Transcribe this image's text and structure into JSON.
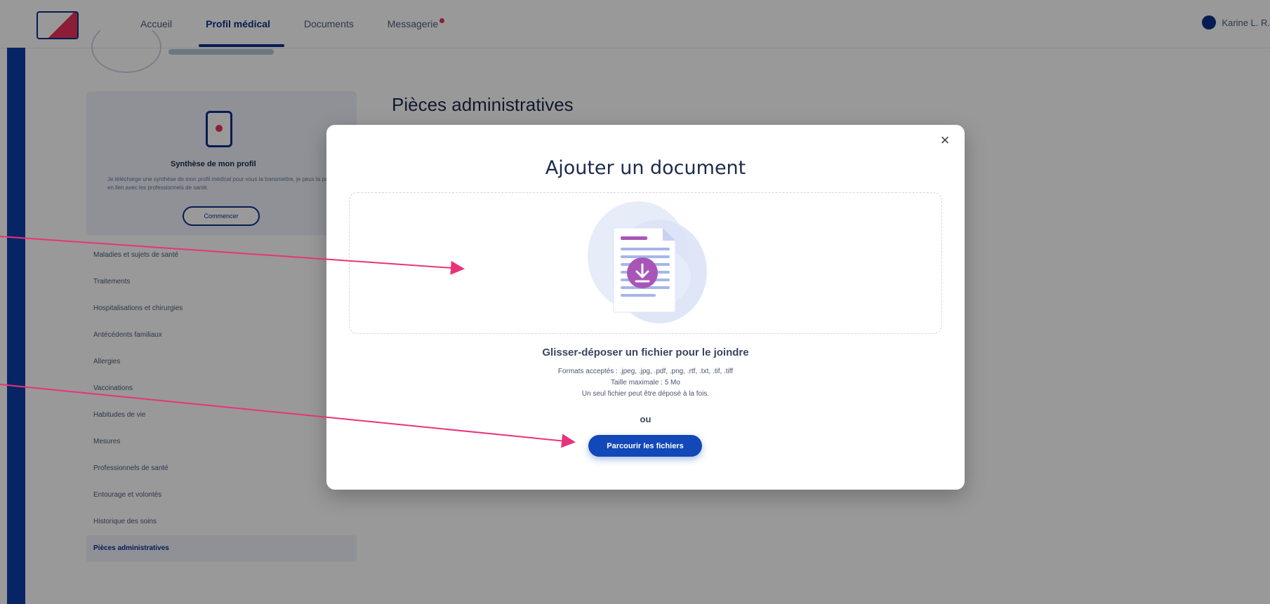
{
  "header": {
    "nav": [
      "Accueil",
      "Profil médical",
      "Documents",
      "Messagerie"
    ],
    "user_label": "Karine L. R."
  },
  "sidebar": {
    "card_title": "Synthèse de mon profil",
    "card_text": "Je télécharge une synthèse de mon profil médical pour vous la transmettre, je peux la partager en lien avec les professionnels de santé.",
    "card_button": "Commencer",
    "items": [
      "Maladies et sujets de santé",
      "Traitements",
      "Hospitalisations et chirurgies",
      "Antécédents familiaux",
      "Allergies",
      "Vaccinations",
      "Habitudes de vie",
      "Mesures",
      "Professionnels de santé",
      "Entourage et volontés",
      "Historique des soins",
      "Pièces administratives"
    ]
  },
  "main": {
    "title": "Pièces administratives"
  },
  "modal": {
    "close": "×",
    "title": "Ajouter un document",
    "drag_text": "Glisser-déposer un fichier pour le joindre",
    "formats": "Formats acceptés : .jpeg, .jpg, .pdf, .png, .rtf, .txt, .tif, .tiff",
    "max_size": "Taille maximale : 5 Mo",
    "single": "Un seul fichier peut être déposé à la fois.",
    "or": "ou",
    "browse_button": "Parcourir les fichiers"
  },
  "colors": {
    "primary": "#1248b8",
    "accent_pink": "#e8335a",
    "doc_purple": "#a855b8",
    "annotation": "#e8337a"
  },
  "icons": [
    "logo-icon",
    "close-icon",
    "document-download-icon",
    "tablet-icon",
    "avatar"
  ]
}
